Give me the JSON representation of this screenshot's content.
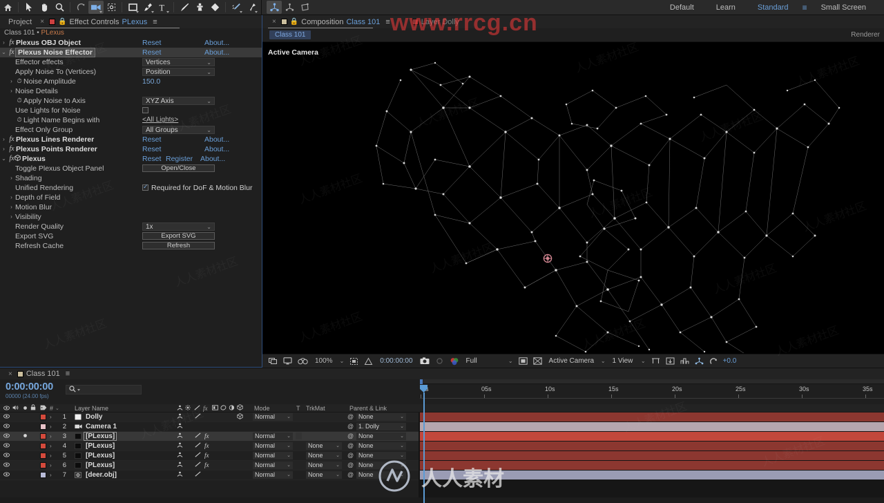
{
  "toolbar": {
    "tools": [
      {
        "name": "home-icon",
        "label": "Home"
      },
      {
        "name": "selection-tool-icon",
        "label": "Selection Tool"
      },
      {
        "name": "hand-tool-icon",
        "label": "Hand Tool"
      },
      {
        "name": "zoom-tool-icon",
        "label": "Zoom Tool"
      },
      {
        "name": "orbit-tool-icon",
        "label": "Orbit Tool"
      },
      {
        "name": "camera-tool-icon",
        "label": "Camera Tool"
      },
      {
        "name": "pan-behind-tool-icon",
        "label": "Pan Behind Tool"
      },
      {
        "name": "shape-tool-icon",
        "label": "Rectangle Tool"
      },
      {
        "name": "pen-tool-icon",
        "label": "Pen Tool"
      },
      {
        "name": "text-tool-icon",
        "label": "Type Tool"
      },
      {
        "name": "brush-tool-icon",
        "label": "Brush Tool"
      },
      {
        "name": "clone-stamp-tool-icon",
        "label": "Clone Stamp Tool"
      },
      {
        "name": "eraser-tool-icon",
        "label": "Eraser Tool"
      },
      {
        "name": "roto-brush-tool-icon",
        "label": "Roto Brush Tool"
      },
      {
        "name": "puppet-pin-tool-icon",
        "label": "Puppet Pin Tool"
      }
    ],
    "camera_tools": [
      {
        "name": "unified-camera-tool-icon",
        "label": "Unified Camera Tool",
        "active": true
      },
      {
        "name": "orbit-camera-tool-icon",
        "label": "Orbit Camera Tool",
        "active": false
      },
      {
        "name": "track-camera-tool-icon",
        "label": "Track Camera Tool",
        "active": false
      }
    ],
    "workspaces": [
      {
        "label": "Default",
        "active": false
      },
      {
        "label": "Learn",
        "active": false
      },
      {
        "label": "Standard",
        "active": true
      },
      {
        "label": "Small Screen",
        "active": false
      }
    ],
    "workspace_menu_icon": "hamburger-menu-icon"
  },
  "effect_controls": {
    "tab_project": "Project",
    "tab_title": "Effect Controls",
    "tab_layer": "PLexus",
    "breadcrumb_comp": "Class 101",
    "breadcrumb_sep": "•",
    "breadcrumb_layer": "PLexus",
    "reset_label": "Reset",
    "about_label": "About...",
    "register_label": "Register",
    "items": [
      {
        "type": "effect",
        "name": "Plexus OBJ Object",
        "expanded": false,
        "selected": false,
        "reset": "Reset",
        "about": "About..."
      },
      {
        "type": "effect",
        "name": "Plexus Noise Effector",
        "expanded": true,
        "selected": true,
        "reset": "Reset",
        "about": "About..."
      },
      {
        "type": "combo",
        "label": "Effector effects",
        "value": "Vertices"
      },
      {
        "type": "combo",
        "label": "Apply Noise To (Vertices)",
        "value": "Position"
      },
      {
        "type": "value",
        "label": "Noise Amplitude",
        "value": "150.0",
        "stopwatch": true,
        "arrow": true
      },
      {
        "type": "group",
        "label": "Noise Details",
        "arrow": true
      },
      {
        "type": "combo",
        "label": "Apply Noise to Axis",
        "value": "XYZ Axis",
        "stopwatch": true
      },
      {
        "type": "checkbox",
        "label": "Use Lights for Noise",
        "checked": false
      },
      {
        "type": "link",
        "label": "Light Name Begins with",
        "value": "<All Lights>",
        "stopwatch": true
      },
      {
        "type": "combo",
        "label": "Effect Only Group",
        "value": "All Groups"
      },
      {
        "type": "effect",
        "name": "Plexus Lines Renderer",
        "expanded": false,
        "reset": "Reset",
        "about": "About..."
      },
      {
        "type": "effect",
        "name": "Plexus Points Renderer",
        "expanded": false,
        "reset": "Reset",
        "about": "About..."
      },
      {
        "type": "effect",
        "name": "Plexus",
        "expanded": true,
        "reset": "Reset",
        "register": "Register",
        "about": "About...",
        "cube_icon": true
      },
      {
        "type": "button",
        "label": "Toggle Plexus Object Panel",
        "value": "Open/Close"
      },
      {
        "type": "group",
        "label": "Shading",
        "arrow": true
      },
      {
        "type": "checkbox_label",
        "label": "Unified Rendering",
        "checked": true,
        "text": "Required for DoF & Motion Blur"
      },
      {
        "type": "group",
        "label": "Depth of Field",
        "arrow": true
      },
      {
        "type": "group",
        "label": "Motion Blur",
        "arrow": true
      },
      {
        "type": "group",
        "label": "Visibility",
        "arrow": true
      },
      {
        "type": "combo",
        "label": "Render Quality",
        "value": "1x"
      },
      {
        "type": "button",
        "label": "Export SVG",
        "value": "Export SVG"
      },
      {
        "type": "button",
        "label": "Refresh Cache",
        "value": "Refresh"
      }
    ]
  },
  "composition": {
    "tab_label": "Composition",
    "tab_name": "Class 101",
    "tab_layer_label": "Layer Dolly",
    "chip_label": "Class 101",
    "renderer_label": "Renderer",
    "view_overlay": "Active Camera",
    "viewer_bar": {
      "zoom": "100%",
      "timecode": "0:00:00:00",
      "resolution": "Full",
      "camera_view": "Active Camera",
      "view_layout": "1 View",
      "exposure": "+0.0",
      "icons": [
        "always-preview-icon",
        "pixel-aspect-icon",
        "fast-previews-icon",
        "region-of-interest-icon",
        "transparency-grid-icon",
        "snapshot-icon",
        "show-snapshot-icon",
        "channel-rgb-icon",
        "toggle-mask-icon",
        "toggle-guides-icon",
        "3d-reference-axes-icon",
        "proportional-grid-icon",
        "ruler-icon",
        "3d-view-popup-icon",
        "reset-exposure-icon"
      ]
    }
  },
  "timeline": {
    "tab_name": "Class 101",
    "timecode": "0:00:00:00",
    "frames_label": "00000 (24.00 fps)",
    "search_placeholder": "",
    "columns": {
      "av_features": "A / V Features",
      "label": "Label",
      "number": "#",
      "layer_name": "Layer Name",
      "switches": "Switches",
      "mode": "Mode",
      "t": "T",
      "trkmat": "TrkMat",
      "parent": "Parent & Link"
    },
    "ruler_ticks": [
      "0s",
      "05s",
      "10s",
      "15s",
      "20s",
      "25s",
      "30s",
      "35s"
    ],
    "layers": [
      {
        "num": "1",
        "name": "Dolly",
        "label_color": "#d44a3c",
        "icon": "null-object-icon",
        "mode": "Normal",
        "trkmat": "",
        "parent": "None",
        "bar_color": "#8c3730",
        "has_fx": false,
        "has_3d": true,
        "selected": false,
        "solo": false
      },
      {
        "num": "2",
        "name": "Camera 1",
        "label_color": "#e8c2c8",
        "icon": "camera-icon",
        "mode": "",
        "trkmat": "",
        "parent": "1. Dolly",
        "bar_color": "#b6a6ae",
        "has_fx": false,
        "has_3d": false,
        "selected": false,
        "solo": false
      },
      {
        "num": "3",
        "name": "[PLexus]",
        "label_color": "#d44a3c",
        "icon": "solid-layer-icon",
        "mode": "Normal",
        "trkmat": "",
        "parent": "None",
        "bar_color": "#c2483c",
        "has_fx": true,
        "has_3d": false,
        "selected": true,
        "solo": true
      },
      {
        "num": "4",
        "name": "[PLexus]",
        "label_color": "#d44a3c",
        "icon": "solid-layer-icon",
        "mode": "Normal",
        "trkmat": "None",
        "parent": "None",
        "bar_color": "#8c3730",
        "has_fx": true,
        "has_3d": false,
        "selected": false,
        "solo": false
      },
      {
        "num": "5",
        "name": "[PLexus]",
        "label_color": "#d44a3c",
        "icon": "solid-layer-icon",
        "mode": "Normal",
        "trkmat": "None",
        "parent": "None",
        "bar_color": "#8c3730",
        "has_fx": true,
        "has_3d": false,
        "selected": false,
        "solo": false
      },
      {
        "num": "6",
        "name": "[PLexus]",
        "label_color": "#d44a3c",
        "icon": "solid-layer-icon",
        "mode": "Normal",
        "trkmat": "None",
        "parent": "None",
        "bar_color": "#8c3730",
        "has_fx": true,
        "has_3d": false,
        "selected": false,
        "solo": false
      },
      {
        "num": "7",
        "name": "[deer.obj]",
        "label_color": "#b9bcd8",
        "icon": "obj-file-icon",
        "mode": "Normal",
        "trkmat": "None",
        "parent": "None",
        "bar_color": "#9a9cb4",
        "has_fx": false,
        "has_3d": false,
        "selected": false,
        "solo": false
      }
    ]
  },
  "watermarks": {
    "url": "www.rrcg.cn",
    "site_cn": "人人素材",
    "tile": "人人素材社区"
  },
  "colors": {
    "accent_blue": "#6a9fd8",
    "panel_bg": "#1f1f1f",
    "tab_bg": "#232323",
    "selection": "#3a3a3a",
    "layer_red": "#8c3730",
    "cti_blue": "#5b9bd5"
  }
}
